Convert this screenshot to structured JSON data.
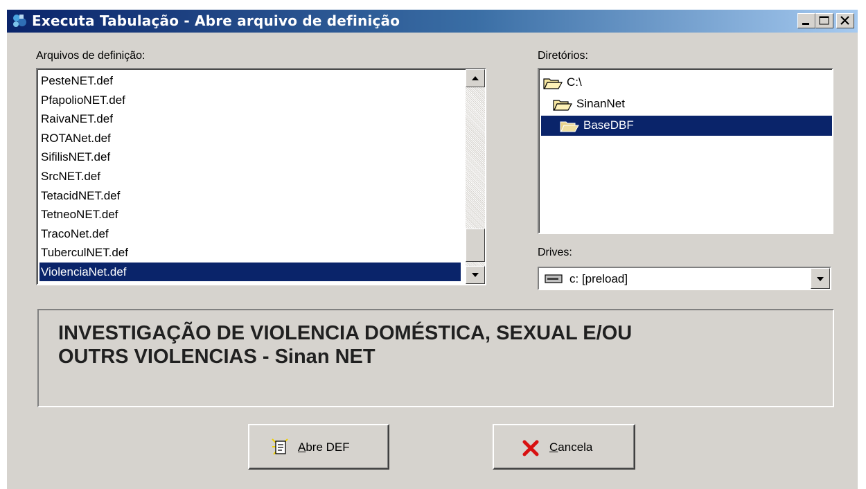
{
  "window": {
    "title": "Executa Tabulação - Abre arquivo de definição"
  },
  "files": {
    "label": "Arquivos de definição:",
    "items": [
      "PesteNET.def",
      "PfapolioNET.def",
      "RaivaNET.def",
      "ROTANet.def",
      "SifilisNET.def",
      "SrcNET.def",
      "TetacidNET.def",
      "TetneoNET.def",
      "TracoNet.def",
      "TuberculNET.def",
      "ViolenciaNet.def"
    ],
    "selected": "ViolenciaNet.def"
  },
  "dirs": {
    "label": "Diretórios:",
    "items": [
      "C:\\",
      "SinanNet",
      "BaseDBF"
    ],
    "selected": "BaseDBF"
  },
  "drives": {
    "label": "Drives:",
    "value": "c: [preload]"
  },
  "description": {
    "line1": "INVESTIGAÇÃO DE VIOLENCIA DOMÉSTICA, SEXUAL E/OU",
    "line2": "OUTRS VIOLENCIAS - Sinan NET"
  },
  "buttons": {
    "open_accel": "A",
    "open_rest": "bre DEF",
    "cancel_accel": "C",
    "cancel_rest": "ancela"
  },
  "colors": {
    "selection": "#0a246a",
    "window": "#d6d3ce",
    "title_start": "#0a246a",
    "title_end": "#a6caf0"
  }
}
